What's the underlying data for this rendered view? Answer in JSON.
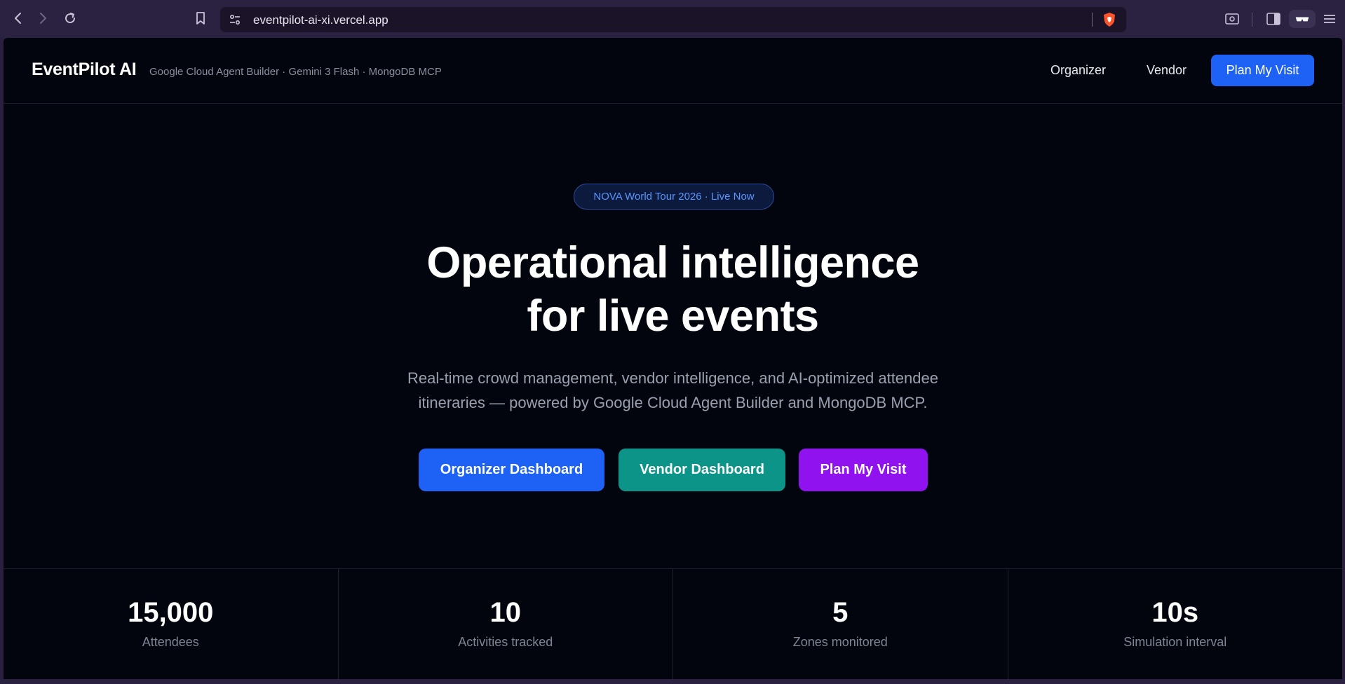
{
  "browser": {
    "url": "eventpilot-ai-xi.vercel.app"
  },
  "header": {
    "brand": "EventPilot AI",
    "tagline": "Google Cloud Agent Builder · Gemini 3 Flash · MongoDB MCP",
    "nav": [
      "Organizer",
      "Vendor"
    ],
    "cta_label": "Plan My Visit"
  },
  "hero": {
    "badge": "NOVA World Tour 2026 · Live Now",
    "title_line1": "Operational intelligence",
    "title_line2": "for live events",
    "desc_line1": "Real-time crowd management, vendor intelligence, and AI-optimized attendee",
    "desc_line2": "itineraries — powered by Google Cloud Agent Builder and MongoDB MCP.",
    "buttons": [
      "Organizer Dashboard",
      "Vendor Dashboard",
      "Plan My Visit"
    ]
  },
  "stats": [
    {
      "value": "15,000",
      "label": "Attendees"
    },
    {
      "value": "10",
      "label": "Activities tracked"
    },
    {
      "value": "5",
      "label": "Zones monitored"
    },
    {
      "value": "10s",
      "label": "Simulation interval"
    }
  ],
  "colors": {
    "accent_blue": "#1d62f5",
    "accent_teal": "#0d9488",
    "accent_purple": "#8f12ef",
    "background": "#03050e"
  },
  "icons": [
    "back-icon",
    "forward-icon",
    "reload-icon",
    "bookmark-icon",
    "site-settings-icon",
    "brave-shield-icon",
    "screenshot-icon",
    "sidebar-icon",
    "reader-mode-icon",
    "menu-icon"
  ]
}
